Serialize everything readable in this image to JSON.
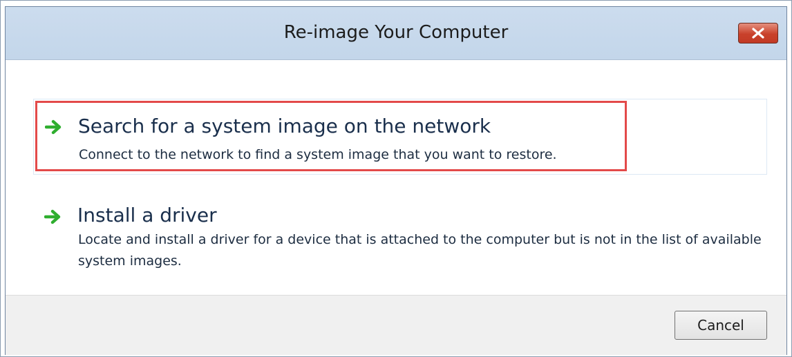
{
  "window": {
    "title": "Re-image Your Computer",
    "close_icon": "close-icon"
  },
  "options": [
    {
      "icon": "green-arrow-icon",
      "title": "Search for a system image on the network",
      "description": "Connect to the network to find a system image that you want to restore.",
      "highlighted": true
    },
    {
      "icon": "green-arrow-icon",
      "title": "Install a driver",
      "description": "Locate and install a driver for a device that is attached to the computer but is not in the list of available system images.",
      "highlighted": false
    }
  ],
  "footer": {
    "cancel_label": "Cancel"
  },
  "colors": {
    "accent_arrow": "#2fae2f",
    "highlight_border": "#e34a4a",
    "close_button": "#c9412b"
  }
}
